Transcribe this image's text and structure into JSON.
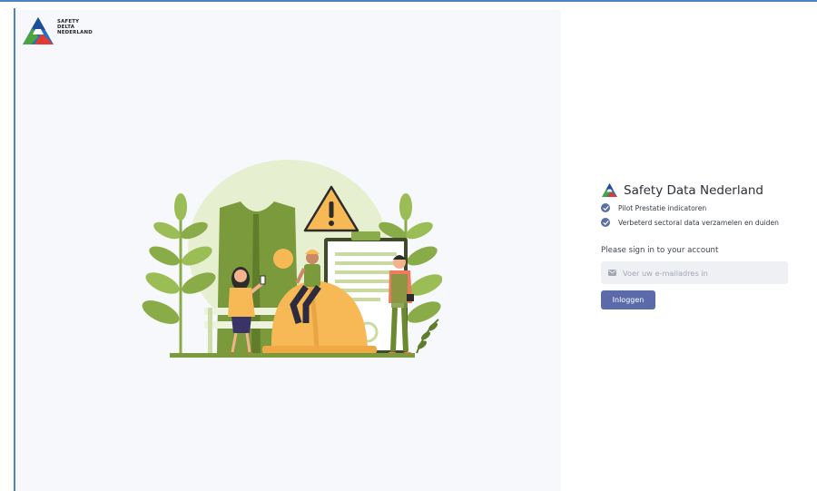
{
  "logo": {
    "lines": [
      "SAFETY",
      "DELTA",
      "NEDERLAND"
    ]
  },
  "panel": {
    "title": "Safety Data Nederland",
    "features": [
      "Pilot Prestatie indicatoren",
      "Verbeterd sectoral data verzamelen en duiden"
    ],
    "signin_heading": "Please sign in to your account",
    "email_placeholder": "Voer uw e-mailadres in",
    "login_label": "Inloggen"
  },
  "icons": {
    "logo": "safety-delta-triangle-icon",
    "feature": "check-circle-icon",
    "email": "mail-icon",
    "warning": "warning-triangle-icon"
  },
  "colors": {
    "accent": "#5b6ba9",
    "frame": "#4f82c2",
    "left_bg": "#f7f8fb",
    "illustration_green": "#7a9a3c",
    "illustration_orange": "#f7b955"
  }
}
